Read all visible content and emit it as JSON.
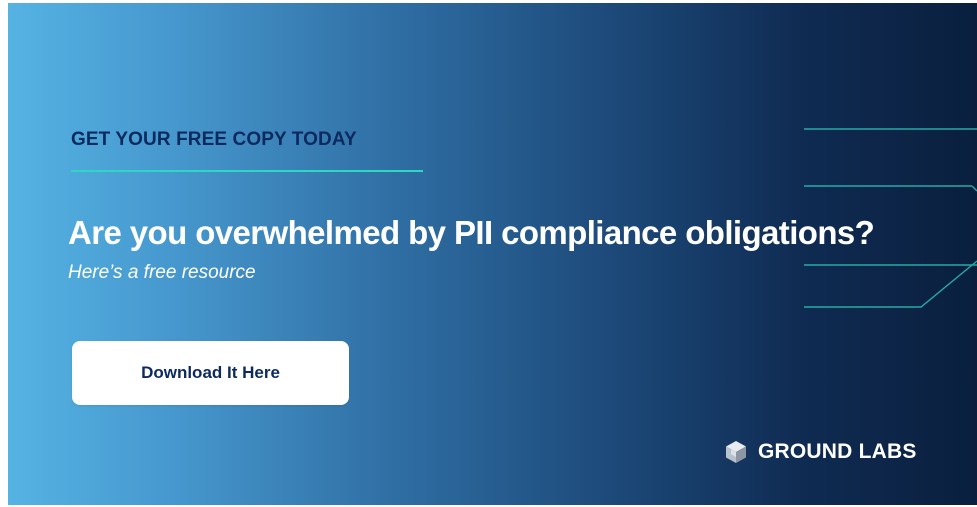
{
  "banner": {
    "eyebrow": "GET YOUR FREE COPY TODAY",
    "headline": "Are you overwhelmed by PII compliance obligations?",
    "subhead": "Here’s a free resource",
    "cta_label": "Download It Here",
    "brand_name": "GROUND LABS"
  },
  "colors": {
    "gradient_start": "#55b3e3",
    "gradient_end": "#0a1f3e",
    "eyebrow_text": "#0d2a5e",
    "accent_line": "#2cd7c4",
    "cta_background": "#ffffff",
    "cta_text": "#0d2a5e"
  },
  "icons": {
    "logo": "ground-labs-logo-icon"
  }
}
